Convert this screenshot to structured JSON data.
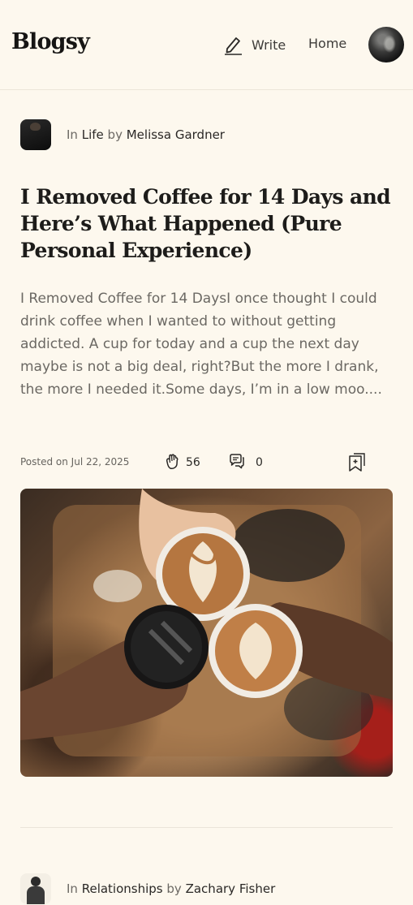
{
  "header": {
    "brand": "Blogsy",
    "write_label": "Write",
    "home_label": "Home"
  },
  "posts": [
    {
      "category_prefix": "In",
      "category": "Life",
      "author_prefix": "by",
      "author": "Melissa Gardner",
      "title": "I Removed Coffee for 14 Days and Here’s What Happened (Pure Personal Experience)",
      "excerpt": "I Removed Coffee for 14 DaysI once thought I could drink coffee when I wanted to without getting addicted. A cup for today and a cup the next day maybe is not a big deal, right?But the more I drank, the more I needed it.Some days, I’m in a low moo....",
      "date": "Posted on Jul 22, 2025",
      "claps": "56",
      "comments": "0",
      "cover_image": "coffee-cups-toast-photo"
    },
    {
      "category_prefix": "In",
      "category": "Relationships",
      "author_prefix": "by",
      "author": "Zachary Fisher"
    }
  ]
}
